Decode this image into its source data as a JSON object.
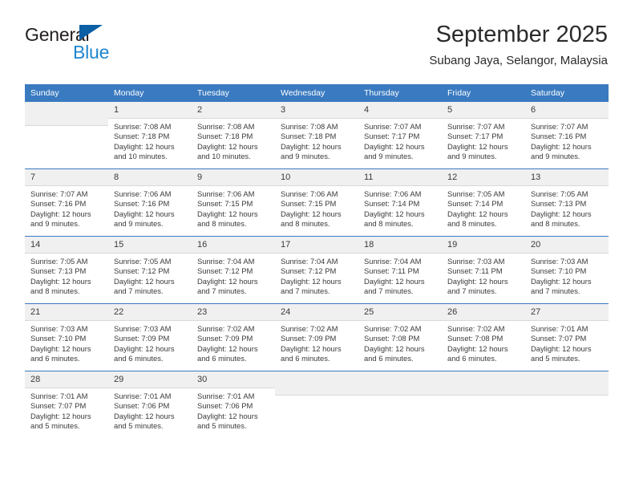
{
  "brand": {
    "name_top": "General",
    "name_bottom": "Blue",
    "accent_color": "#1f86d0",
    "logo_triangle_color": "#0b5fa5",
    "triangle_icon": "triangle-icon"
  },
  "header": {
    "title": "September 2025",
    "location": "Subang Jaya, Selangor, Malaysia"
  },
  "theme": {
    "header_bar_color": "#3a7ac0",
    "daynum_background": "#f0f0f0",
    "text_color": "#3a3a3a"
  },
  "labels": {
    "sunrise_prefix": "Sunrise:",
    "sunset_prefix": "Sunset:",
    "daylight_prefix": "Daylight:"
  },
  "weekday_headers": [
    "Sunday",
    "Monday",
    "Tuesday",
    "Wednesday",
    "Thursday",
    "Friday",
    "Saturday"
  ],
  "weeks": [
    [
      {
        "day": "",
        "sunrise": "",
        "sunset": "",
        "daylight_line1": "",
        "daylight_line2": ""
      },
      {
        "day": "1",
        "sunrise": "Sunrise: 7:08 AM",
        "sunset": "Sunset: 7:18 PM",
        "daylight_line1": "Daylight: 12 hours",
        "daylight_line2": "and 10 minutes."
      },
      {
        "day": "2",
        "sunrise": "Sunrise: 7:08 AM",
        "sunset": "Sunset: 7:18 PM",
        "daylight_line1": "Daylight: 12 hours",
        "daylight_line2": "and 10 minutes."
      },
      {
        "day": "3",
        "sunrise": "Sunrise: 7:08 AM",
        "sunset": "Sunset: 7:18 PM",
        "daylight_line1": "Daylight: 12 hours",
        "daylight_line2": "and 9 minutes."
      },
      {
        "day": "4",
        "sunrise": "Sunrise: 7:07 AM",
        "sunset": "Sunset: 7:17 PM",
        "daylight_line1": "Daylight: 12 hours",
        "daylight_line2": "and 9 minutes."
      },
      {
        "day": "5",
        "sunrise": "Sunrise: 7:07 AM",
        "sunset": "Sunset: 7:17 PM",
        "daylight_line1": "Daylight: 12 hours",
        "daylight_line2": "and 9 minutes."
      },
      {
        "day": "6",
        "sunrise": "Sunrise: 7:07 AM",
        "sunset": "Sunset: 7:16 PM",
        "daylight_line1": "Daylight: 12 hours",
        "daylight_line2": "and 9 minutes."
      }
    ],
    [
      {
        "day": "7",
        "sunrise": "Sunrise: 7:07 AM",
        "sunset": "Sunset: 7:16 PM",
        "daylight_line1": "Daylight: 12 hours",
        "daylight_line2": "and 9 minutes."
      },
      {
        "day": "8",
        "sunrise": "Sunrise: 7:06 AM",
        "sunset": "Sunset: 7:16 PM",
        "daylight_line1": "Daylight: 12 hours",
        "daylight_line2": "and 9 minutes."
      },
      {
        "day": "9",
        "sunrise": "Sunrise: 7:06 AM",
        "sunset": "Sunset: 7:15 PM",
        "daylight_line1": "Daylight: 12 hours",
        "daylight_line2": "and 8 minutes."
      },
      {
        "day": "10",
        "sunrise": "Sunrise: 7:06 AM",
        "sunset": "Sunset: 7:15 PM",
        "daylight_line1": "Daylight: 12 hours",
        "daylight_line2": "and 8 minutes."
      },
      {
        "day": "11",
        "sunrise": "Sunrise: 7:06 AM",
        "sunset": "Sunset: 7:14 PM",
        "daylight_line1": "Daylight: 12 hours",
        "daylight_line2": "and 8 minutes."
      },
      {
        "day": "12",
        "sunrise": "Sunrise: 7:05 AM",
        "sunset": "Sunset: 7:14 PM",
        "daylight_line1": "Daylight: 12 hours",
        "daylight_line2": "and 8 minutes."
      },
      {
        "day": "13",
        "sunrise": "Sunrise: 7:05 AM",
        "sunset": "Sunset: 7:13 PM",
        "daylight_line1": "Daylight: 12 hours",
        "daylight_line2": "and 8 minutes."
      }
    ],
    [
      {
        "day": "14",
        "sunrise": "Sunrise: 7:05 AM",
        "sunset": "Sunset: 7:13 PM",
        "daylight_line1": "Daylight: 12 hours",
        "daylight_line2": "and 8 minutes."
      },
      {
        "day": "15",
        "sunrise": "Sunrise: 7:05 AM",
        "sunset": "Sunset: 7:12 PM",
        "daylight_line1": "Daylight: 12 hours",
        "daylight_line2": "and 7 minutes."
      },
      {
        "day": "16",
        "sunrise": "Sunrise: 7:04 AM",
        "sunset": "Sunset: 7:12 PM",
        "daylight_line1": "Daylight: 12 hours",
        "daylight_line2": "and 7 minutes."
      },
      {
        "day": "17",
        "sunrise": "Sunrise: 7:04 AM",
        "sunset": "Sunset: 7:12 PM",
        "daylight_line1": "Daylight: 12 hours",
        "daylight_line2": "and 7 minutes."
      },
      {
        "day": "18",
        "sunrise": "Sunrise: 7:04 AM",
        "sunset": "Sunset: 7:11 PM",
        "daylight_line1": "Daylight: 12 hours",
        "daylight_line2": "and 7 minutes."
      },
      {
        "day": "19",
        "sunrise": "Sunrise: 7:03 AM",
        "sunset": "Sunset: 7:11 PM",
        "daylight_line1": "Daylight: 12 hours",
        "daylight_line2": "and 7 minutes."
      },
      {
        "day": "20",
        "sunrise": "Sunrise: 7:03 AM",
        "sunset": "Sunset: 7:10 PM",
        "daylight_line1": "Daylight: 12 hours",
        "daylight_line2": "and 7 minutes."
      }
    ],
    [
      {
        "day": "21",
        "sunrise": "Sunrise: 7:03 AM",
        "sunset": "Sunset: 7:10 PM",
        "daylight_line1": "Daylight: 12 hours",
        "daylight_line2": "and 6 minutes."
      },
      {
        "day": "22",
        "sunrise": "Sunrise: 7:03 AM",
        "sunset": "Sunset: 7:09 PM",
        "daylight_line1": "Daylight: 12 hours",
        "daylight_line2": "and 6 minutes."
      },
      {
        "day": "23",
        "sunrise": "Sunrise: 7:02 AM",
        "sunset": "Sunset: 7:09 PM",
        "daylight_line1": "Daylight: 12 hours",
        "daylight_line2": "and 6 minutes."
      },
      {
        "day": "24",
        "sunrise": "Sunrise: 7:02 AM",
        "sunset": "Sunset: 7:09 PM",
        "daylight_line1": "Daylight: 12 hours",
        "daylight_line2": "and 6 minutes."
      },
      {
        "day": "25",
        "sunrise": "Sunrise: 7:02 AM",
        "sunset": "Sunset: 7:08 PM",
        "daylight_line1": "Daylight: 12 hours",
        "daylight_line2": "and 6 minutes."
      },
      {
        "day": "26",
        "sunrise": "Sunrise: 7:02 AM",
        "sunset": "Sunset: 7:08 PM",
        "daylight_line1": "Daylight: 12 hours",
        "daylight_line2": "and 6 minutes."
      },
      {
        "day": "27",
        "sunrise": "Sunrise: 7:01 AM",
        "sunset": "Sunset: 7:07 PM",
        "daylight_line1": "Daylight: 12 hours",
        "daylight_line2": "and 5 minutes."
      }
    ],
    [
      {
        "day": "28",
        "sunrise": "Sunrise: 7:01 AM",
        "sunset": "Sunset: 7:07 PM",
        "daylight_line1": "Daylight: 12 hours",
        "daylight_line2": "and 5 minutes."
      },
      {
        "day": "29",
        "sunrise": "Sunrise: 7:01 AM",
        "sunset": "Sunset: 7:06 PM",
        "daylight_line1": "Daylight: 12 hours",
        "daylight_line2": "and 5 minutes."
      },
      {
        "day": "30",
        "sunrise": "Sunrise: 7:01 AM",
        "sunset": "Sunset: 7:06 PM",
        "daylight_line1": "Daylight: 12 hours",
        "daylight_line2": "and 5 minutes."
      },
      {
        "day": "",
        "sunrise": "",
        "sunset": "",
        "daylight_line1": "",
        "daylight_line2": ""
      },
      {
        "day": "",
        "sunrise": "",
        "sunset": "",
        "daylight_line1": "",
        "daylight_line2": ""
      },
      {
        "day": "",
        "sunrise": "",
        "sunset": "",
        "daylight_line1": "",
        "daylight_line2": ""
      },
      {
        "day": "",
        "sunrise": "",
        "sunset": "",
        "daylight_line1": "",
        "daylight_line2": ""
      }
    ]
  ]
}
